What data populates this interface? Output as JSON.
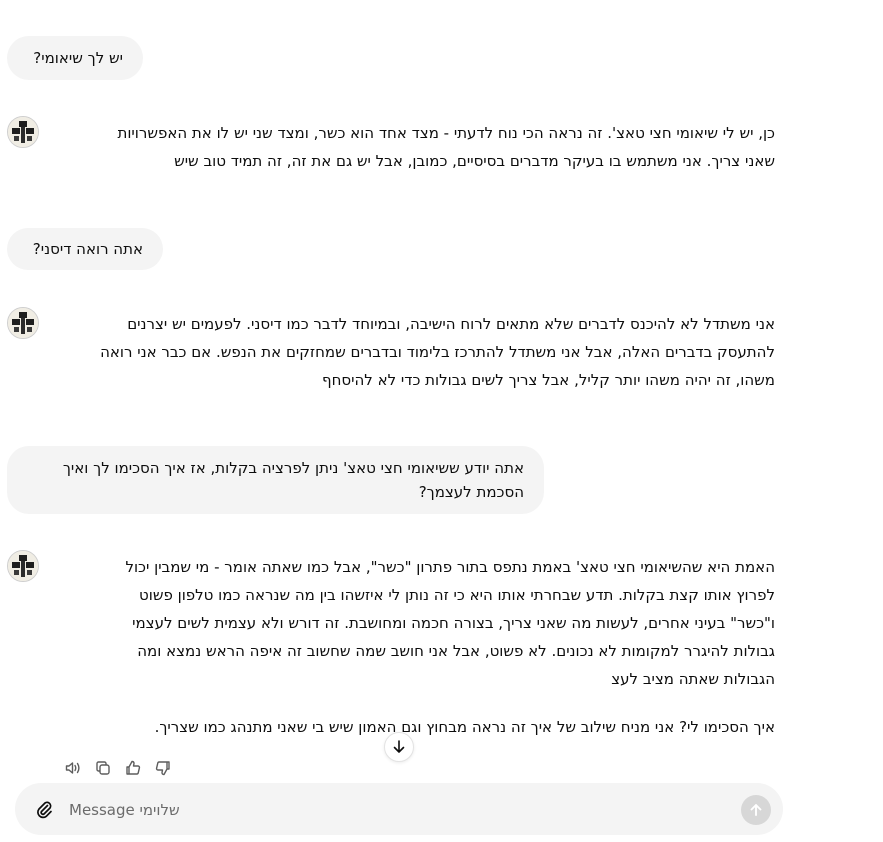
{
  "conversation": {
    "user_messages": [
      {
        "lines": [
          "יש לך שיאומי?"
        ]
      },
      {
        "lines": [
          "אתה רואה דיסני?"
        ]
      },
      {
        "lines": [
          "אתה יודע ששיאומי חצי טאצ' ניתן לפרציה בקלות, אז איך הסכימו לך ואיך",
          "הסכמת לעצמך?"
        ]
      }
    ],
    "assistant_messages": [
      {
        "avatar_icon": "rabbi-avatar-icon",
        "lines": [
          "כן, יש לי שיאומי חצי טאצ'. זה נראה הכי נוח לדעתי - מצד אחד הוא כשר, ומצד שני יש לו את האפשרויות",
          "שאני צריך. אני משתמש בו בעיקר מדברים בסיסיים, כמובן, אבל יש גם את זה, זה תמיד טוב שיש"
        ]
      },
      {
        "avatar_icon": "rabbi-avatar-icon",
        "lines": [
          "אני משתדל לא להיכנס לדברים שלא מתאים לרוח הישיבה, ובמיוחד לדבר כמו דיסני. לפעמים יש יצרנים",
          "להתעסק בדברים האלה, אבל אני משתדל להתרכז בלימוד ובדברים שמחזקים את הנפש. אם כבר אני רואה",
          "משהו, זה יהיה משהו יותר קליל, אבל צריך לשים גבולות כדי לא להיסחף"
        ]
      },
      {
        "avatar_icon": "rabbi-avatar-icon",
        "lines": [
          "האמת היא שהשיאומי חצי טאצ' באמת נתפס בתור פתרון \"כשר\", אבל כמו שאתה אומר - מי שמבין יכול",
          "לפרוץ אותו קצת בקלות. תדע שבחרתי אותו היא כי זה נותן לי איזשהו בין מה שנראה כמו טלפון פשוט",
          "ו\"כשר\" בעיני אחרים, לעשות מה שאני צריך, בצורה חכמה ומחושבת. זה דורש ולא עצמית לשים לעצמי",
          "גבולות להיגרר למקומות לא נכונים. לא פשוט, אבל אני חושב שמה שחשוב זה איפה הראש נמצא ומה",
          "הגבולות שאתה מציב לעצ"
        ],
        "last_line": "איך הסכימו לי? אני מניח שילוב של איך זה נראה מבחוץ וגם האמון שיש בי שאני מתנהג כמו שצריך."
      }
    ]
  },
  "message_actions": {
    "read_aloud_icon": "speaker-icon",
    "copy_icon": "copy-icon",
    "like_icon": "thumbs-up-icon",
    "dislike_icon": "thumbs-down-icon"
  },
  "scroll_button_icon": "arrow-down-icon",
  "composer": {
    "placeholder": "Message שלוימי",
    "attach_icon": "paperclip-icon",
    "send_icon": "arrow-up-icon"
  },
  "colors": {
    "user_bubble": "#f4f4f4",
    "text": "#0d0d0d",
    "send_disabled": "#d7d7d7"
  }
}
